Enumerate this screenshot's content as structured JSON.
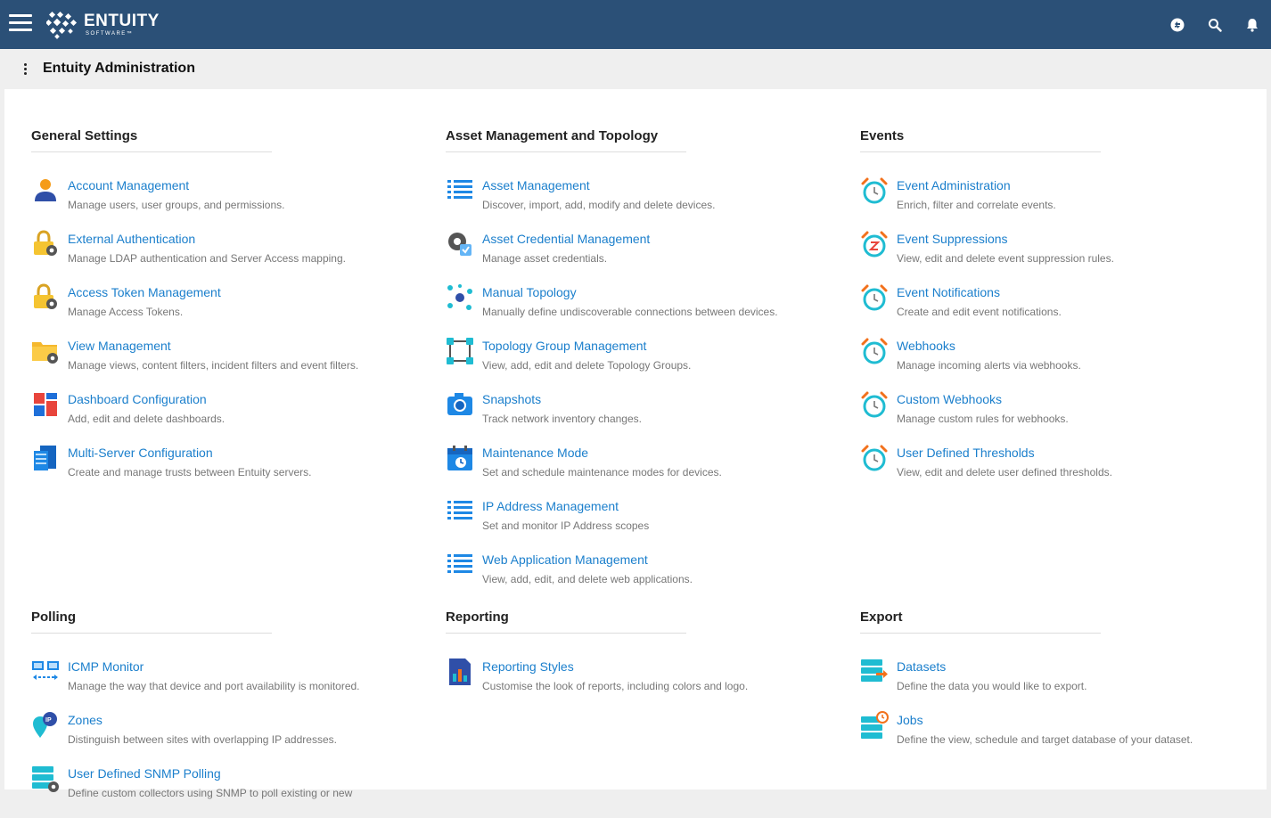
{
  "app": {
    "logo_name": "ENTUITY",
    "logo_sub": "SOFTWARE™",
    "page_title": "Entuity Administration"
  },
  "colors": {
    "header": "#2b5077",
    "link": "#1b7fcc",
    "desc": "#777777"
  },
  "sections": {
    "general": {
      "title": "General Settings",
      "items": [
        {
          "icon": "user-icon",
          "name": "Account Management",
          "desc": "Manage users, user groups, and permissions."
        },
        {
          "icon": "lock-gear-icon",
          "name": "External Authentication",
          "desc": "Manage LDAP authentication and Server Access mapping."
        },
        {
          "icon": "lock-gear-icon",
          "name": "Access Token Management",
          "desc": "Manage Access Tokens."
        },
        {
          "icon": "folder-gear-icon",
          "name": "View Management",
          "desc": "Manage views, content filters, incident filters and event filters."
        },
        {
          "icon": "dashboard-icon",
          "name": "Dashboard Configuration",
          "desc": "Add, edit and delete dashboards."
        },
        {
          "icon": "server-icon",
          "name": "Multi-Server Configuration",
          "desc": "Create and manage trusts between Entuity servers."
        }
      ]
    },
    "asset": {
      "title": "Asset Management and Topology",
      "items": [
        {
          "icon": "list-icon",
          "name": "Asset Management",
          "desc": "Discover, import, add, modify and delete devices."
        },
        {
          "icon": "gear-credential-icon",
          "name": "Asset Credential Management",
          "desc": "Manage asset credentials."
        },
        {
          "icon": "topology-icon",
          "name": "Manual Topology",
          "desc": "Manually define undiscoverable connections between devices."
        },
        {
          "icon": "topology-group-icon",
          "name": "Topology Group Management",
          "desc": "View, add, edit and delete Topology Groups."
        },
        {
          "icon": "camera-icon",
          "name": "Snapshots",
          "desc": "Track network inventory changes."
        },
        {
          "icon": "calendar-clock-icon",
          "name": "Maintenance Mode",
          "desc": "Set and schedule maintenance modes for devices."
        },
        {
          "icon": "list-icon",
          "name": "IP Address Management",
          "desc": "Set and monitor IP Address scopes"
        },
        {
          "icon": "list-icon",
          "name": "Web Application Management",
          "desc": "View, add, edit, and delete web applications."
        }
      ]
    },
    "events": {
      "title": "Events",
      "items": [
        {
          "icon": "alarm-clock-icon",
          "name": "Event Administration",
          "desc": "Enrich, filter and correlate events."
        },
        {
          "icon": "alarm-clock-z-icon",
          "name": "Event Suppressions",
          "desc": "View, edit and delete event suppression rules."
        },
        {
          "icon": "alarm-clock-icon",
          "name": "Event Notifications",
          "desc": "Create and edit event notifications."
        },
        {
          "icon": "alarm-clock-icon",
          "name": "Webhooks",
          "desc": "Manage incoming alerts via webhooks."
        },
        {
          "icon": "alarm-clock-icon",
          "name": "Custom Webhooks",
          "desc": "Manage custom rules for webhooks."
        },
        {
          "icon": "alarm-clock-icon",
          "name": "User Defined Thresholds",
          "desc": "View, edit and delete user defined thresholds."
        }
      ]
    },
    "polling": {
      "title": "Polling",
      "items": [
        {
          "icon": "icmp-monitor-icon",
          "name": "ICMP Monitor",
          "desc": "Manage the way that device and port availability is monitored."
        },
        {
          "icon": "zones-pin-icon",
          "name": "Zones",
          "desc": "Distinguish between sites with overlapping IP addresses."
        },
        {
          "icon": "database-gear-icon",
          "name": "User Defined SNMP Polling",
          "desc": "Define custom collectors using SNMP to poll existing or new"
        }
      ]
    },
    "reporting": {
      "title": "Reporting",
      "items": [
        {
          "icon": "report-chart-icon",
          "name": "Reporting Styles",
          "desc": "Customise the look of reports, including colors and logo."
        }
      ]
    },
    "export": {
      "title": "Export",
      "items": [
        {
          "icon": "database-export-icon",
          "name": "Datasets",
          "desc": "Define the data you would like to export."
        },
        {
          "icon": "database-clock-icon",
          "name": "Jobs",
          "desc": "Define the view, schedule and target database of your dataset."
        }
      ]
    }
  }
}
